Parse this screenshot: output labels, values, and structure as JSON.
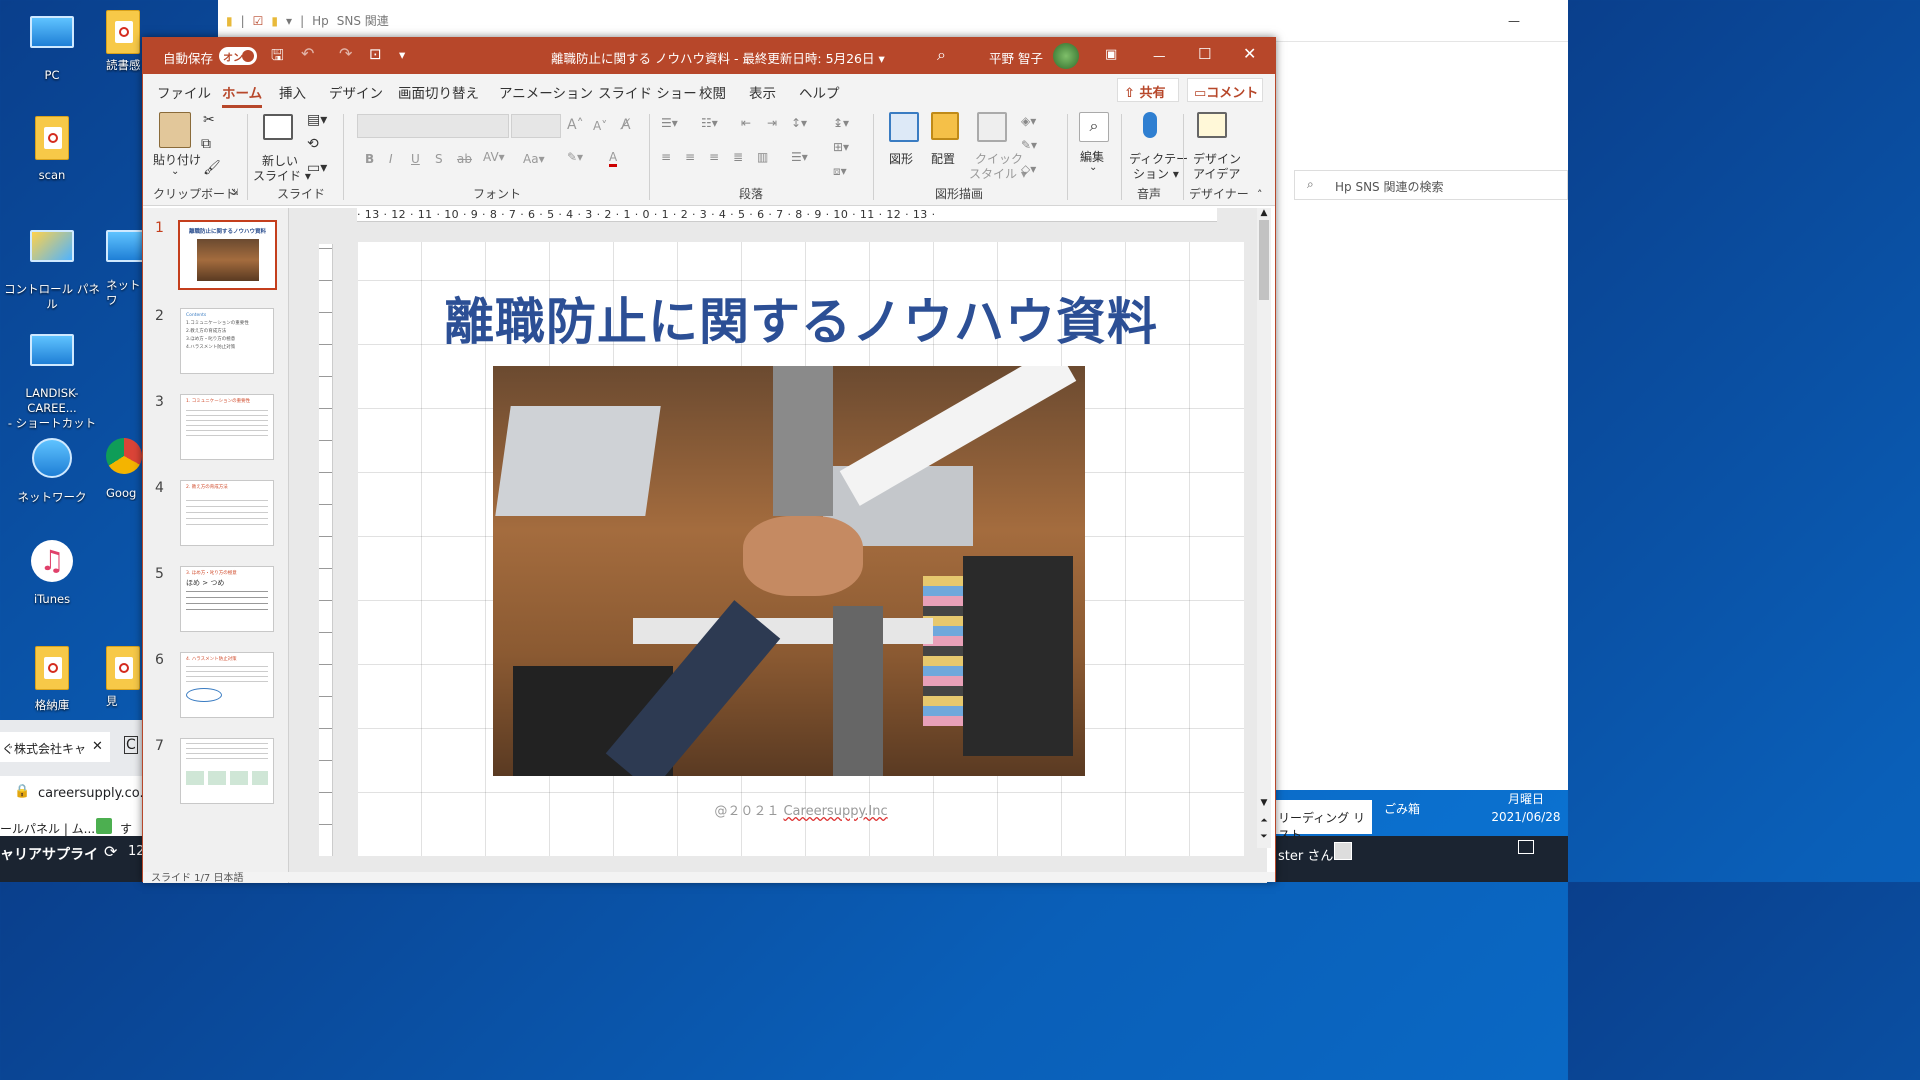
{
  "desktop": {
    "icons": [
      "PC",
      "読書感",
      "scan",
      "コントロール パネル",
      "ネットワ",
      "LANDISK-CAREE...",
      "- ショートカット",
      "ネットワーク",
      "Goog",
      "iTunes",
      "格納庫",
      "見"
    ]
  },
  "explorer": {
    "path_sep": "|",
    "folder": "Hp",
    "title": "SNS 関連",
    "search_placeholder": "Hp   SNS 関連の検索"
  },
  "browser": {
    "tab": "ぐ株式会社キャ",
    "tab_close": "✕",
    "tab2": "C",
    "url": "careersupply.co.jp",
    "bookmark1": "ールパネル | ム...",
    "bookmark2": "すら"
  },
  "taskbar": {
    "app": "ャリアサプライ",
    "num": "12",
    "reading_list": "リーディング リスト",
    "user": "ster さん",
    "recycle": "ごみ箱",
    "day": "月曜日",
    "date": "2021/06/28"
  },
  "ppt": {
    "autosave_label": "自動保存",
    "autosave_state": "オン",
    "doc_title": "離職防止に関する ノウハウ資料  -  最終更新日時: 5月26日  ▾",
    "user": "平野 智子",
    "tabs": [
      "ファイル",
      "ホーム",
      "挿入",
      "デザイン",
      "画面切り替え",
      "アニメーション",
      "スライド ショー",
      "校閲",
      "表示",
      "ヘルプ"
    ],
    "share": "共有",
    "comment": "コメント",
    "ribbon": {
      "paste": "貼り付け",
      "new_slide": "新しい",
      "new_slide2": "スライド ▾",
      "clipboard": "クリップボード",
      "slides": "スライド",
      "font": "フォント",
      "paragraph": "段落",
      "drawing": "図形描画",
      "voice": "音声",
      "designer": "デザイナー",
      "shapes": "図形",
      "arrange": "配置",
      "quick1": "クイック",
      "quick2": "スタイル ▾",
      "edit": "編集",
      "dictate1": "ディクテー",
      "dictate2": "ション ▾",
      "design1": "デザイン",
      "design2": "アイデア"
    },
    "ruler_h": "· 13 · 12 · 11 · 10 · 9 · 8 · 7 · 6 · 5 · 4 · 3 · 2 · 1 · 0 · 1 · 2 · 3 · 4 · 5 · 6 · 7 · 8 · 9 · 10 · 11 · 12 · 13 ·",
    "slide_numbers": [
      "1",
      "2",
      "3",
      "4",
      "5",
      "6",
      "7"
    ],
    "slide": {
      "title": "離職防止に関するノウハウ資料",
      "footer_prefix": "@２０２１  ",
      "footer_brand": "Careersuppy.Inc"
    },
    "thumbs": {
      "t1": "離職防止に関するノウハウ資料",
      "t2a": "Contents",
      "t2b": "1.コミュニケーションの重要性",
      "t2c": "2.教え方の育成方法",
      "t2d": "3.ほめ方・叱り方の極意",
      "t2e": "4.ハラスメント防止対策",
      "t3": "1. コミュニケーションの重要性",
      "t4": "2. 教え方の育成方法",
      "t5": "3. ほめ方・叱り方の極意",
      "t5b": "ほめ",
      "t5c": "つめ",
      "t6": "4. ハラスメント防止対策"
    },
    "status": "スライド 1/7    日本語"
  }
}
